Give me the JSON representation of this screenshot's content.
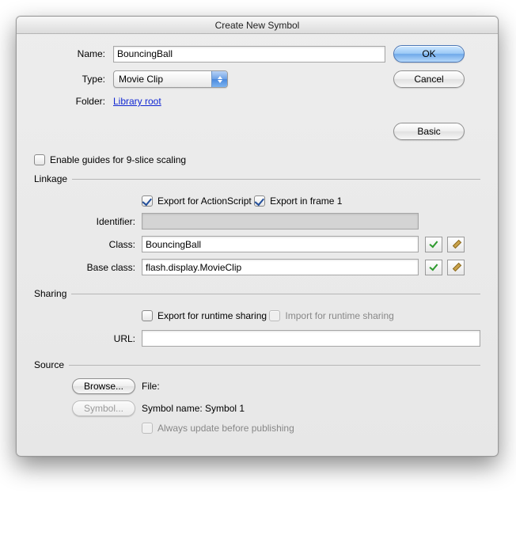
{
  "window": {
    "title": "Create New Symbol"
  },
  "labels": {
    "name": "Name:",
    "type": "Type:",
    "folder": "Folder:",
    "identifier": "Identifier:",
    "class": "Class:",
    "baseclass": "Base class:",
    "url": "URL:",
    "file": "File:"
  },
  "fields": {
    "name": "BouncingBall",
    "type": "Movie Clip",
    "folder_link": "Library root",
    "identifier": "",
    "class": "BouncingBall",
    "baseclass": "flash.display.MovieClip",
    "url": "",
    "file_value": "",
    "symbol_name": "Symbol name: Symbol 1"
  },
  "buttons": {
    "ok": "OK",
    "cancel": "Cancel",
    "basic": "Basic",
    "browse": "Browse...",
    "symbol": "Symbol..."
  },
  "checks": {
    "nine_slice": "Enable guides for 9-slice scaling",
    "export_as": "Export for ActionScript",
    "export_frame1": "Export in frame 1",
    "export_runtime": "Export for runtime sharing",
    "import_runtime": "Import for runtime sharing",
    "always_update": "Always update before publishing"
  },
  "groups": {
    "linkage": "Linkage",
    "sharing": "Sharing",
    "source": "Source"
  }
}
